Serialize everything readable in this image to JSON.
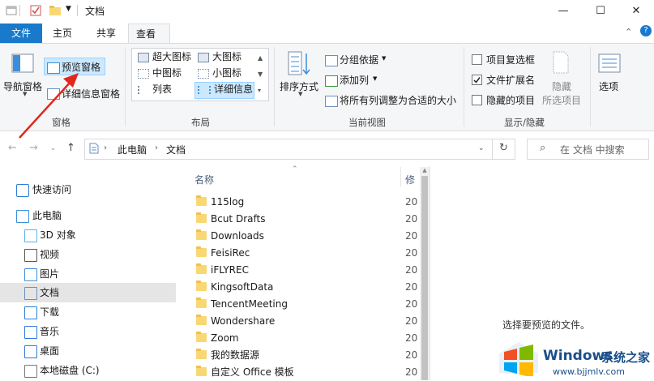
{
  "window": {
    "title": "文档",
    "minimize_icon": "minimize-icon",
    "maximize_icon": "maximize-icon",
    "close_icon": "close-icon"
  },
  "ribbon_tabs": [
    "文件",
    "主页",
    "共享",
    "查看"
  ],
  "ribbon": {
    "panes": {
      "nav_pane": "导航窗格",
      "preview_pane": "预览窗格",
      "details_pane": "详细信息窗格",
      "group_label": "窗格"
    },
    "layout": {
      "items": [
        "超大图标",
        "大图标",
        "中图标",
        "小图标",
        "列表",
        "详细信息"
      ],
      "group_label": "布局"
    },
    "current_view": {
      "sort_by": "排序方式",
      "group_by": "分组依据",
      "add_column": "添加列",
      "fit_columns": "将所有列调整为合适的大小",
      "group_label": "当前视图"
    },
    "show_hide": {
      "item_checkboxes": "项目复选框",
      "file_extensions": "文件扩展名",
      "hidden_items": "隐藏的项目",
      "hide": "隐藏",
      "selected_items": "所选项目",
      "group_label": "显示/隐藏",
      "file_extensions_checked": true,
      "item_checkboxes_checked": false,
      "hidden_items_checked": false
    },
    "options": "选项"
  },
  "address": {
    "crumbs": [
      "此电脑",
      "文档"
    ],
    "search_placeholder": "在 文档 中搜索"
  },
  "nav_pane": {
    "items": [
      {
        "label": "快速访问",
        "icon": "star-icon"
      },
      {
        "label": "此电脑",
        "icon": "computer-icon"
      },
      {
        "label": "3D 对象",
        "icon": "cube-icon"
      },
      {
        "label": "视频",
        "icon": "video-icon"
      },
      {
        "label": "图片",
        "icon": "picture-icon"
      },
      {
        "label": "文档",
        "icon": "document-icon"
      },
      {
        "label": "下载",
        "icon": "download-icon"
      },
      {
        "label": "音乐",
        "icon": "music-icon"
      },
      {
        "label": "桌面",
        "icon": "desktop-icon"
      },
      {
        "label": "本地磁盘 (C:)",
        "icon": "drive-icon"
      }
    ]
  },
  "file_list": {
    "header_name": "名称",
    "header_date": "修",
    "date_prefix": "20",
    "files": [
      "115log",
      "Bcut Drafts",
      "Downloads",
      "FeisiRec",
      "iFLYREC",
      "KingsoftData",
      "TencentMeeting",
      "Wondershare",
      "Zoom",
      "我的数据源",
      "自定义 Office 模板"
    ]
  },
  "preview": {
    "message": "选择要预览的文件。"
  },
  "watermark": {
    "brand": "Windows",
    "site_cn": "系统之家",
    "url": "www.bjjmlv.com"
  },
  "colors": {
    "file_tab_bg": "#1979ca",
    "accent": "#1979ca",
    "selected_nav": "#cce8ff",
    "arrow": "#e0281e"
  }
}
